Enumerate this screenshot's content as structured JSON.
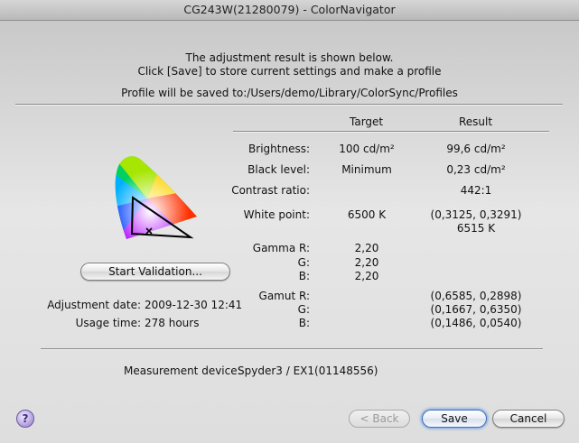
{
  "window": {
    "title": "CG243W(21280079) - ColorNavigator"
  },
  "header": {
    "line1": "The adjustment result is shown below.",
    "line2": "Click [Save] to store current settings and make a profile",
    "line3": "Profile will be saved to:/Users/demo/Library/ColorSync/Profiles"
  },
  "table": {
    "col_target": "Target",
    "col_result": "Result",
    "brightness": {
      "label": "Brightness:",
      "target": "100 cd/m²",
      "result": "99,6 cd/m²"
    },
    "black_level": {
      "label": "Black level:",
      "target": "Minimum",
      "result": "0,23 cd/m²"
    },
    "contrast": {
      "label": "Contrast ratio:",
      "result": "442:1"
    },
    "white_point": {
      "label": "White point:",
      "target": "6500 K",
      "result_xy": "(0,3125, 0,3291)",
      "result_k": "6515 K"
    },
    "gamma": {
      "label_r": "Gamma R:",
      "label_g": "G:",
      "label_b": "B:",
      "r": "2,20",
      "g": "2,20",
      "b": "2,20"
    },
    "gamut": {
      "label_r": "Gamut R:",
      "label_g": "G:",
      "label_b": "B:",
      "r": "(0,6585, 0,2898)",
      "g": "(0,1667, 0,6350)",
      "b": "(0,1486, 0,0540)"
    }
  },
  "left": {
    "validation_button": "Start Validation...",
    "adjustment_date_label": "Adjustment date:",
    "adjustment_date": "2009-12-30 12:41",
    "usage_time_label": "Usage time:",
    "usage_time": "278 hours"
  },
  "footer": {
    "device_label": "Measurement device:",
    "device_value": "Spyder3 / EX1(01148556)",
    "help_label": "?",
    "back_button": "< Back",
    "save_button": "Save",
    "cancel_button": "Cancel"
  }
}
